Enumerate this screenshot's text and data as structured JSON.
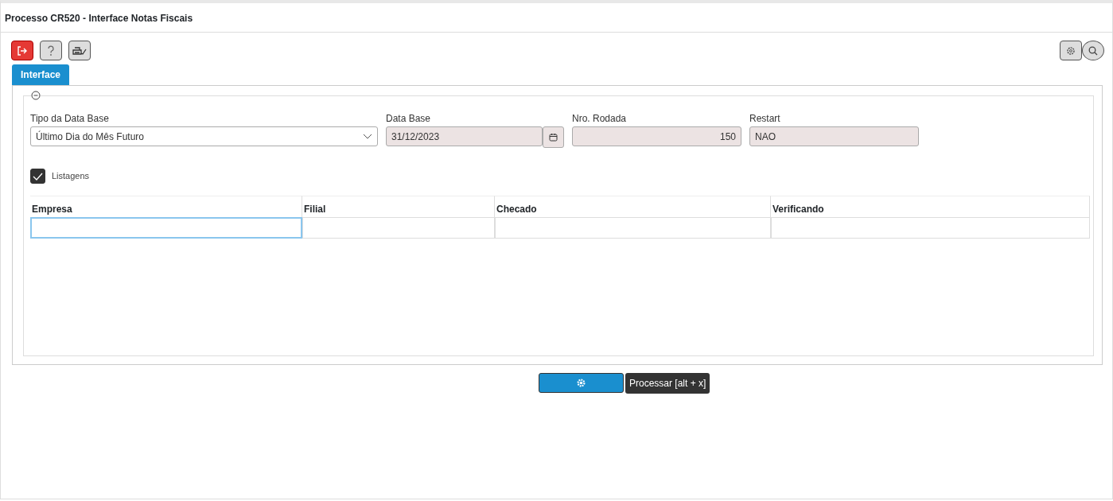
{
  "window": {
    "title": "Processo CR520 - Interface Notas Fiscais"
  },
  "tabs": [
    {
      "label": "Interface",
      "selected": true
    }
  ],
  "fields": [
    {
      "label": "Tipo da Data Base",
      "value": "Último Dia do Mês Futuro",
      "kind": "select"
    },
    {
      "label": "Data Base",
      "value": "31/12/2023",
      "kind": "date"
    },
    {
      "label": "Nro. Rodada",
      "value": "150",
      "kind": "number"
    },
    {
      "label": "Restart",
      "value": "NAO",
      "kind": "text"
    }
  ],
  "checkbox": {
    "label": "Listagens",
    "checked": true
  },
  "table": {
    "columns": [
      "Empresa",
      "Filial",
      "Checado",
      "Verificando"
    ]
  },
  "tooltip": "Processar [alt + x]"
}
